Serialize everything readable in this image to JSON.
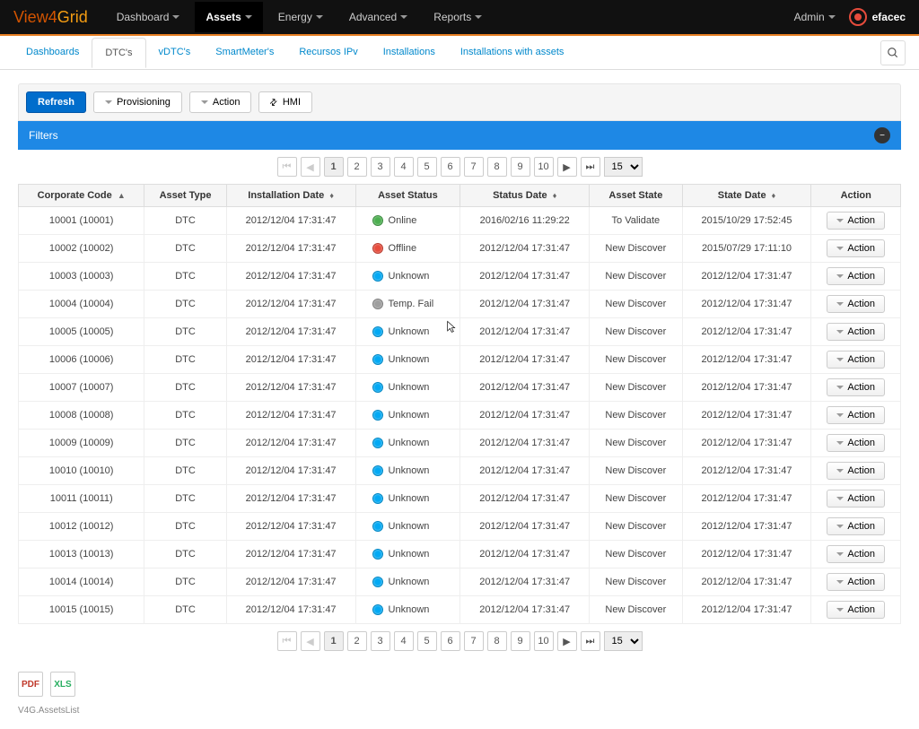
{
  "brand": {
    "v4": "View4",
    "g": "Grid"
  },
  "topnav": [
    {
      "label": "Dashboard",
      "active": false
    },
    {
      "label": "Assets",
      "active": true
    },
    {
      "label": "Energy",
      "active": false
    },
    {
      "label": "Advanced",
      "active": false
    },
    {
      "label": "Reports",
      "active": false
    }
  ],
  "admin_label": "Admin",
  "company": "efacec",
  "subnav": [
    {
      "label": "Dashboards",
      "active": false
    },
    {
      "label": "DTC's",
      "active": true
    },
    {
      "label": "vDTC's",
      "active": false
    },
    {
      "label": "SmartMeter's",
      "active": false
    },
    {
      "label": "Recursos IPv",
      "active": false
    },
    {
      "label": "Installations",
      "active": false
    },
    {
      "label": "Installations with assets",
      "active": false
    }
  ],
  "toolbar": {
    "refresh": "Refresh",
    "provisioning": "Provisioning",
    "action": "Action",
    "hmi": "HMI"
  },
  "filters_label": "Filters",
  "pager": {
    "pages": [
      "1",
      "2",
      "3",
      "4",
      "5",
      "6",
      "7",
      "8",
      "9",
      "10"
    ],
    "page_size": "15"
  },
  "columns": [
    {
      "label": "Corporate Code",
      "sort": "asc"
    },
    {
      "label": "Asset Type",
      "sort": null
    },
    {
      "label": "Installation Date",
      "sort": "both"
    },
    {
      "label": "Asset Status",
      "sort": null
    },
    {
      "label": "Status Date",
      "sort": "both"
    },
    {
      "label": "Asset State",
      "sort": null
    },
    {
      "label": "State Date",
      "sort": "both"
    },
    {
      "label": "Action",
      "sort": null
    }
  ],
  "rows": [
    {
      "code": "10001 (10001)",
      "type": "DTC",
      "inst": "2012/12/04 17:31:47",
      "status": "Online",
      "dot": "online",
      "sdate": "2016/02/16 11:29:22",
      "state": "To Validate",
      "stdate": "2015/10/29 17:52:45"
    },
    {
      "code": "10002 (10002)",
      "type": "DTC",
      "inst": "2012/12/04 17:31:47",
      "status": "Offline",
      "dot": "offline",
      "sdate": "2012/12/04 17:31:47",
      "state": "New Discover",
      "stdate": "2015/07/29 17:11:10"
    },
    {
      "code": "10003 (10003)",
      "type": "DTC",
      "inst": "2012/12/04 17:31:47",
      "status": "Unknown",
      "dot": "unknown",
      "sdate": "2012/12/04 17:31:47",
      "state": "New Discover",
      "stdate": "2012/12/04 17:31:47"
    },
    {
      "code": "10004 (10004)",
      "type": "DTC",
      "inst": "2012/12/04 17:31:47",
      "status": "Temp. Fail",
      "dot": "tempfail",
      "sdate": "2012/12/04 17:31:47",
      "state": "New Discover",
      "stdate": "2012/12/04 17:31:47"
    },
    {
      "code": "10005 (10005)",
      "type": "DTC",
      "inst": "2012/12/04 17:31:47",
      "status": "Unknown",
      "dot": "unknown",
      "sdate": "2012/12/04 17:31:47",
      "state": "New Discover",
      "stdate": "2012/12/04 17:31:47"
    },
    {
      "code": "10006 (10006)",
      "type": "DTC",
      "inst": "2012/12/04 17:31:47",
      "status": "Unknown",
      "dot": "unknown",
      "sdate": "2012/12/04 17:31:47",
      "state": "New Discover",
      "stdate": "2012/12/04 17:31:47"
    },
    {
      "code": "10007 (10007)",
      "type": "DTC",
      "inst": "2012/12/04 17:31:47",
      "status": "Unknown",
      "dot": "unknown",
      "sdate": "2012/12/04 17:31:47",
      "state": "New Discover",
      "stdate": "2012/12/04 17:31:47"
    },
    {
      "code": "10008 (10008)",
      "type": "DTC",
      "inst": "2012/12/04 17:31:47",
      "status": "Unknown",
      "dot": "unknown",
      "sdate": "2012/12/04 17:31:47",
      "state": "New Discover",
      "stdate": "2012/12/04 17:31:47"
    },
    {
      "code": "10009 (10009)",
      "type": "DTC",
      "inst": "2012/12/04 17:31:47",
      "status": "Unknown",
      "dot": "unknown",
      "sdate": "2012/12/04 17:31:47",
      "state": "New Discover",
      "stdate": "2012/12/04 17:31:47"
    },
    {
      "code": "10010 (10010)",
      "type": "DTC",
      "inst": "2012/12/04 17:31:47",
      "status": "Unknown",
      "dot": "unknown",
      "sdate": "2012/12/04 17:31:47",
      "state": "New Discover",
      "stdate": "2012/12/04 17:31:47"
    },
    {
      "code": "10011 (10011)",
      "type": "DTC",
      "inst": "2012/12/04 17:31:47",
      "status": "Unknown",
      "dot": "unknown",
      "sdate": "2012/12/04 17:31:47",
      "state": "New Discover",
      "stdate": "2012/12/04 17:31:47"
    },
    {
      "code": "10012 (10012)",
      "type": "DTC",
      "inst": "2012/12/04 17:31:47",
      "status": "Unknown",
      "dot": "unknown",
      "sdate": "2012/12/04 17:31:47",
      "state": "New Discover",
      "stdate": "2012/12/04 17:31:47"
    },
    {
      "code": "10013 (10013)",
      "type": "DTC",
      "inst": "2012/12/04 17:31:47",
      "status": "Unknown",
      "dot": "unknown",
      "sdate": "2012/12/04 17:31:47",
      "state": "New Discover",
      "stdate": "2012/12/04 17:31:47"
    },
    {
      "code": "10014 (10014)",
      "type": "DTC",
      "inst": "2012/12/04 17:31:47",
      "status": "Unknown",
      "dot": "unknown",
      "sdate": "2012/12/04 17:31:47",
      "state": "New Discover",
      "stdate": "2012/12/04 17:31:47"
    },
    {
      "code": "10015 (10015)",
      "type": "DTC",
      "inst": "2012/12/04 17:31:47",
      "status": "Unknown",
      "dot": "unknown",
      "sdate": "2012/12/04 17:31:47",
      "state": "New Discover",
      "stdate": "2012/12/04 17:31:47"
    }
  ],
  "action_label": "Action",
  "footer": "V4G.AssetsList",
  "exports": {
    "pdf": "PDF",
    "xls": "XLS"
  }
}
